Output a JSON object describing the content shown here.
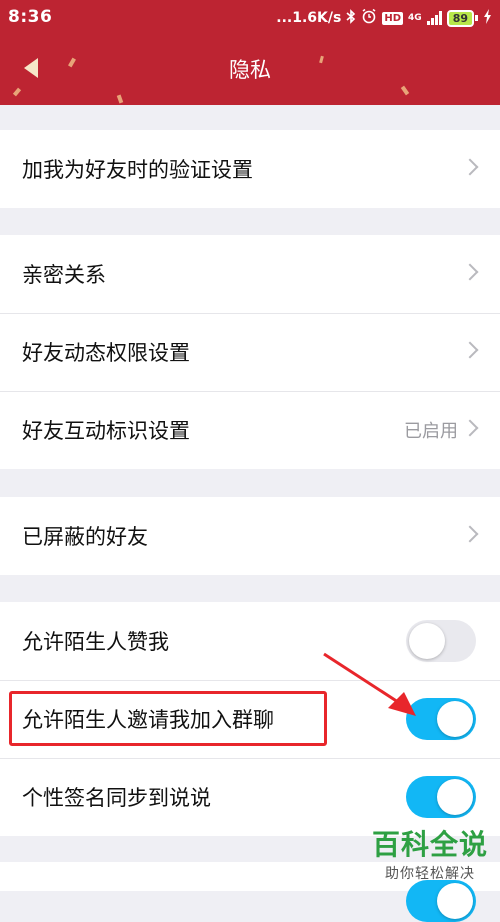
{
  "status": {
    "time": "8:36",
    "net_speed": "...1.6K/s",
    "hd_badge": "HD",
    "network": "4G",
    "battery": "89"
  },
  "header": {
    "title": "隐私"
  },
  "groups": [
    {
      "rows": [
        {
          "label": "加我为好友时的验证设置",
          "value": ""
        }
      ]
    },
    {
      "rows": [
        {
          "label": "亲密关系",
          "value": ""
        },
        {
          "label": "好友动态权限设置",
          "value": ""
        },
        {
          "label": "好友互动标识设置",
          "value": "已启用"
        }
      ]
    },
    {
      "rows": [
        {
          "label": "已屏蔽的好友",
          "value": ""
        }
      ]
    },
    {
      "rows": [
        {
          "label": "允许陌生人赞我",
          "toggle": false
        },
        {
          "label": "允许陌生人邀请我加入群聊",
          "toggle": true
        },
        {
          "label": "个性签名同步到说说",
          "toggle": true
        }
      ]
    }
  ],
  "watermark": {
    "main": "百科全说",
    "sub": "助你轻松解决"
  },
  "colors": {
    "header": "#bd2432",
    "toggle_on": "#12b7f5",
    "highlight": "#e8262b",
    "watermark": "#2ea043"
  }
}
